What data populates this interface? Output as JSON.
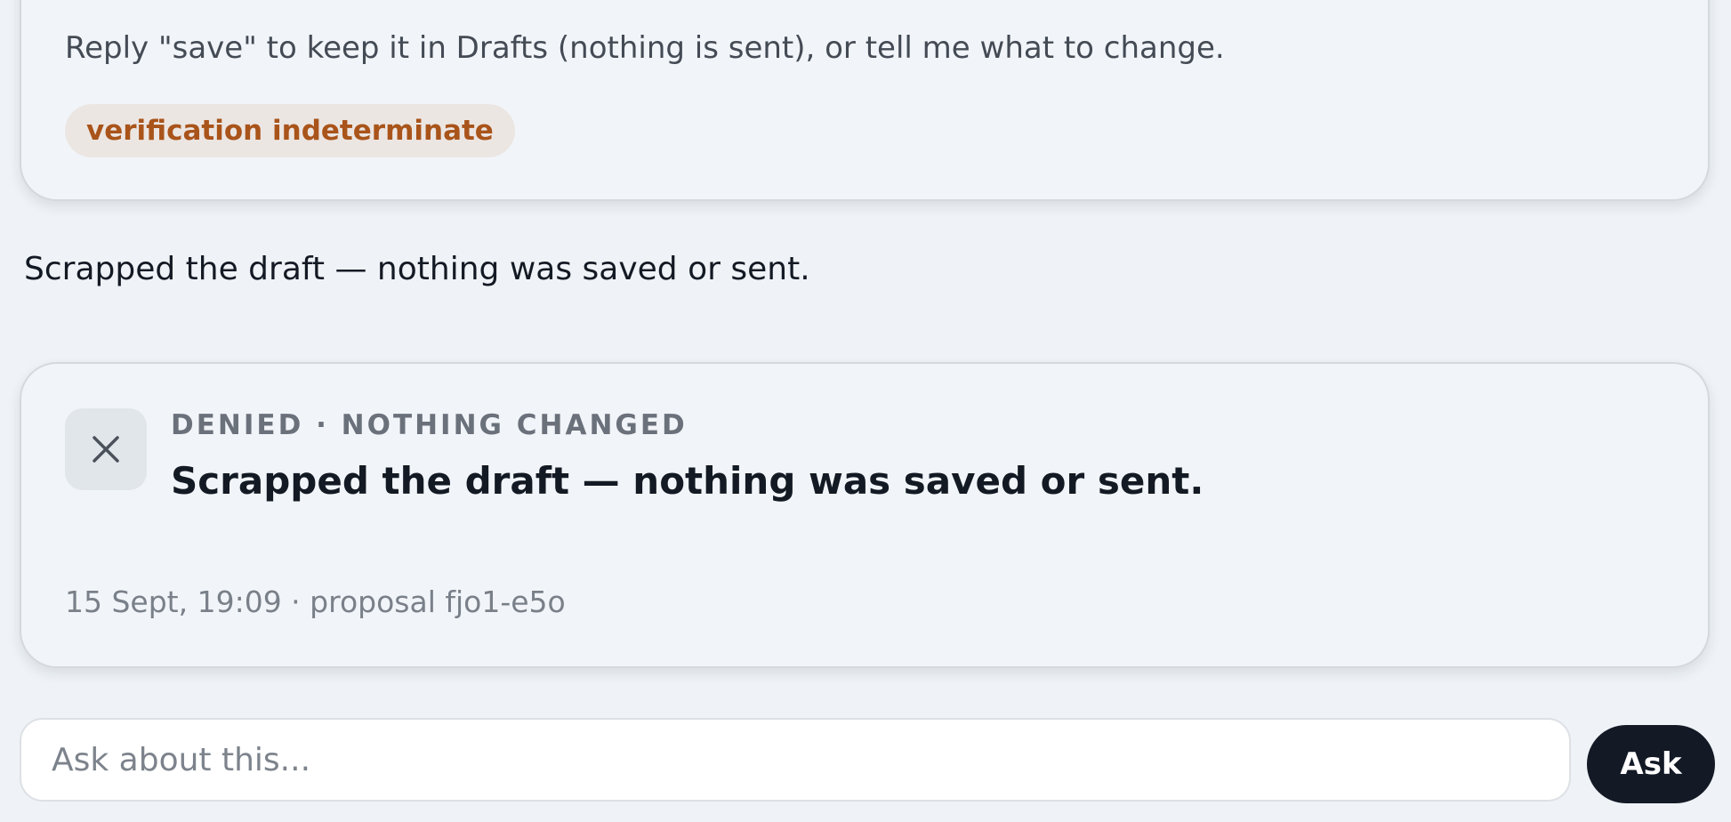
{
  "proposal_card": {
    "reply_instruction": "Reply \"save\" to keep it in Drafts (nothing is sent), or tell me what to change.",
    "verification_badge": "verification indeterminate",
    "badge_colors": {
      "background": "#ece6e3",
      "text": "#a9541a"
    }
  },
  "assistant_message": {
    "text": "Scrapped the draft — nothing was saved or sent."
  },
  "denied_card": {
    "icon": "close-icon",
    "eyebrow": "DENIED · NOTHING CHANGED",
    "title": "Scrapped the draft — nothing was saved or sent.",
    "meta": "15 Sept, 19:09 · proposal fjo1-e5o"
  },
  "composer": {
    "placeholder": "Ask about this...",
    "value": "",
    "ask_label": "Ask",
    "button_color": "#131a26"
  }
}
